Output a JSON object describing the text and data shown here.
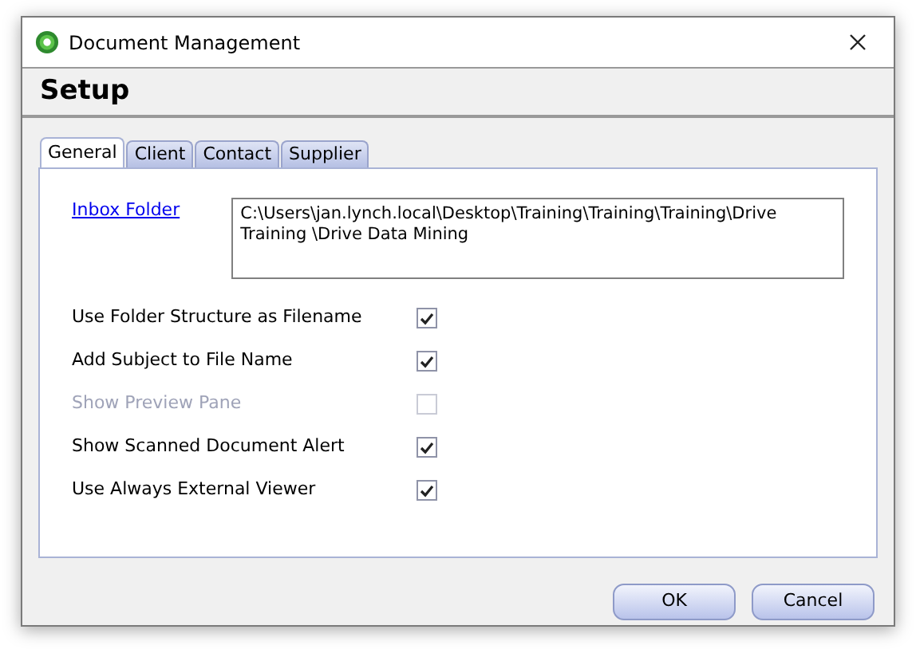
{
  "window": {
    "title": "Document Management"
  },
  "header": {
    "title": "Setup"
  },
  "tabs": [
    {
      "label": "General",
      "selected": true
    },
    {
      "label": "Client",
      "selected": false
    },
    {
      "label": "Contact",
      "selected": false
    },
    {
      "label": "Supplier",
      "selected": false
    }
  ],
  "inbox_folder": {
    "label": "Inbox Folder",
    "value": "C:\\Users\\jan.lynch.local\\Desktop\\Training\\Training\\Training\\Drive Training \\Drive Data Mining"
  },
  "options": [
    {
      "label": "Use Folder Structure as Filename",
      "checked": true,
      "disabled": false
    },
    {
      "label": "Add Subject to File Name",
      "checked": true,
      "disabled": false
    },
    {
      "label": "Show Preview Pane",
      "checked": false,
      "disabled": true
    },
    {
      "label": "Show Scanned Document Alert",
      "checked": true,
      "disabled": false
    },
    {
      "label": "Use Always External Viewer",
      "checked": true,
      "disabled": false
    }
  ],
  "buttons": [
    "OK",
    "Cancel"
  ]
}
